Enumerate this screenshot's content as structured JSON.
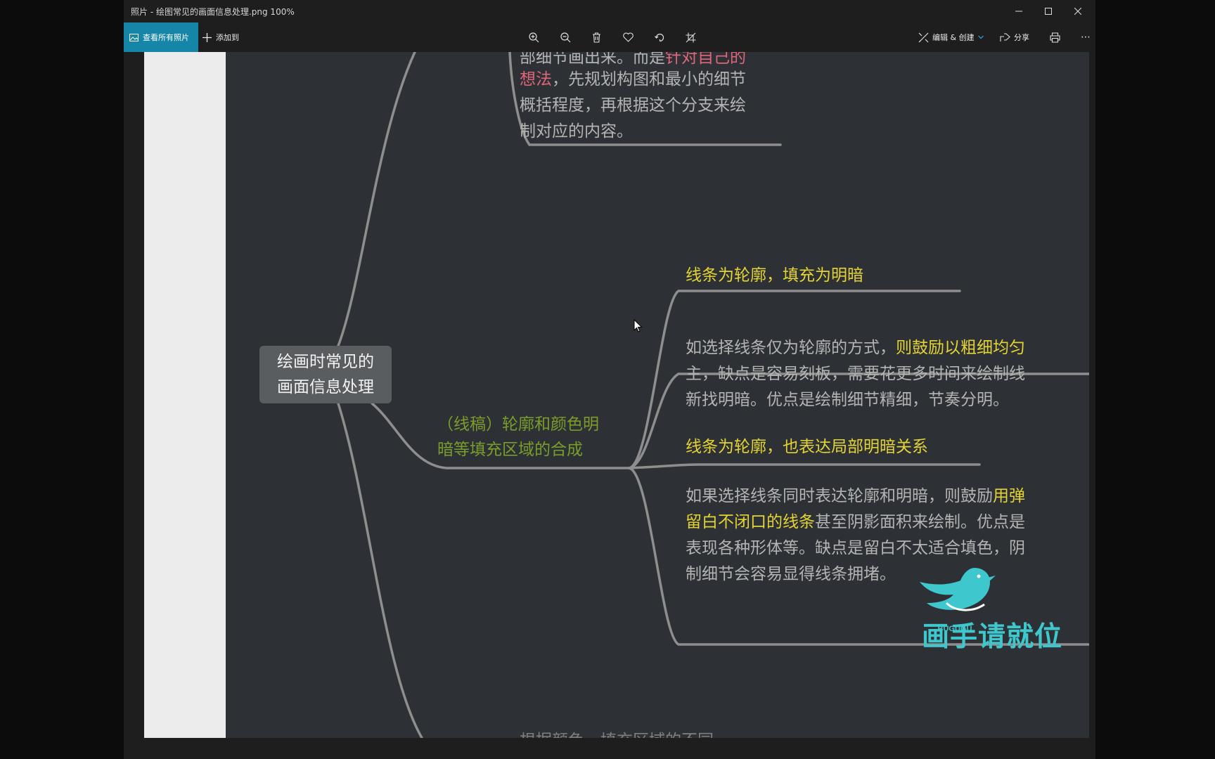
{
  "window": {
    "title": "照片 - 绘图常见的画面信息处理.png   100%",
    "controls": [
      "minimize-icon",
      "maximize-icon",
      "close-icon"
    ]
  },
  "toolbar": {
    "view_all_label": "查看所有照片",
    "add_to_label": "添加到",
    "icons": [
      "zoom-in-icon",
      "zoom-out-icon",
      "delete-icon",
      "favorite-icon",
      "rotate-icon",
      "crop-icon"
    ],
    "edit_create_label": "编辑 & 创建",
    "share_label": "分享",
    "more_label": "⋯"
  },
  "mindmap": {
    "root": "绘画时常见的\n画面信息处理",
    "root_lines": [
      "绘画时常见的",
      "画面信息处理"
    ],
    "top_note": {
      "line1_gray": "部细节画出来。而是",
      "line1_pink": "针对自己的",
      "line2_pink": "想法",
      "line2_gray": "，先规划构图和最小的细节",
      "line3": "概括程度，再根据这个分支来绘",
      "line4": "制对应的内容。"
    },
    "branch": {
      "line1": "（线稿）轮廓和颜色明",
      "line2": "暗等填充区域的合成"
    },
    "sub1": {
      "title": "线条为轮廓，填充为明暗",
      "l1_gray": "如选择线条仅为轮廓的方式，",
      "l1_yellow": "则鼓励以粗细均匀",
      "l2": "主，缺点是容易刻板，需要花更多时间来绘制线",
      "l3": "新找明暗。优点是绘制细节精细，节奏分明。"
    },
    "sub2": {
      "title": "线条为轮廓，也表达局部明暗关系",
      "l1_gray": "如果选择线条同时表达轮廓和明暗，则鼓励",
      "l1_yellow": "用弹",
      "l2_yellow": "留白不闭口的线条",
      "l2_gray": "甚至阴影面积来绘制。优点是",
      "l3": "表现各种形体等。缺点是留白不太适合填色，阴",
      "l4": "制细节会容易显得线条拥堵。"
    },
    "bottom_partial": "根据颜色，填充区域的不同"
  },
  "watermark": {
    "text": "画手请就位",
    "sub": "BUGUGU",
    "color": "#3ec7cc"
  },
  "colors": {
    "accent": "#1586a8",
    "canvas": "#2d3135",
    "highlight_yellow": "#e3d335",
    "highlight_green": "#7a9d2a",
    "highlight_pink": "#e0667a"
  }
}
